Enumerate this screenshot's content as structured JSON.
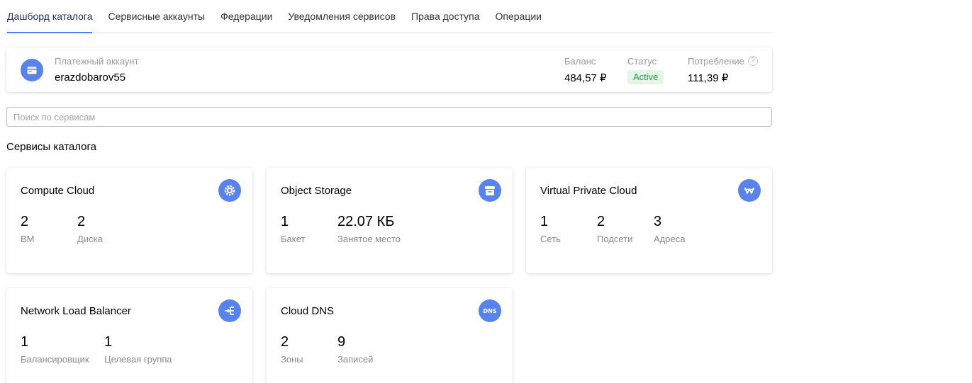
{
  "tabs": [
    {
      "label": "Дашборд каталога",
      "active": true
    },
    {
      "label": "Сервисные аккаунты"
    },
    {
      "label": "Федерации"
    },
    {
      "label": "Уведомления сервисов"
    },
    {
      "label": "Права доступа"
    },
    {
      "label": "Операции"
    }
  ],
  "billing": {
    "label": "Платежный аккаунт",
    "name": "erazdobarov55",
    "icon": "credit-card-icon",
    "balance_label": "Баланс",
    "balance": "484,57 ₽",
    "status_label": "Статус",
    "status": "Active",
    "consumption_label": "Потребление",
    "consumption": "111,39 ₽",
    "help_glyph": "?"
  },
  "search": {
    "placeholder": "Поиск по сервисам",
    "value": ""
  },
  "section_title": "Сервисы каталога",
  "colors": {
    "accent": "#5883ec",
    "active_tab_underline": "#4f7ff0",
    "status_green": "#2a9c41",
    "status_bg": "#e3f6e7"
  },
  "services": [
    {
      "title": "Compute Cloud",
      "icon": "gear-chip-icon",
      "metrics": [
        {
          "value": "2",
          "label": "ВМ"
        },
        {
          "value": "2",
          "label": "Диска"
        }
      ]
    },
    {
      "title": "Object Storage",
      "icon": "storage-box-icon",
      "metrics": [
        {
          "value": "1",
          "label": "Бакет"
        },
        {
          "value": "22.07 КБ",
          "label": "Занятое место"
        }
      ]
    },
    {
      "title": "Virtual Private Cloud",
      "icon": "network-tree-icon",
      "metrics": [
        {
          "value": "1",
          "label": "Сеть"
        },
        {
          "value": "2",
          "label": "Подсети"
        },
        {
          "value": "3",
          "label": "Адреса"
        }
      ]
    },
    {
      "title": "Network Load Balancer",
      "icon": "balancer-icon",
      "metrics": [
        {
          "value": "1",
          "label": "Балансировщик"
        },
        {
          "value": "1",
          "label": "Целевая группа"
        }
      ]
    },
    {
      "title": "Cloud DNS",
      "icon": "dns-icon",
      "icon_text": "DNS",
      "metrics": [
        {
          "value": "2",
          "label": "Зоны"
        },
        {
          "value": "9",
          "label": "Записей"
        }
      ]
    }
  ]
}
